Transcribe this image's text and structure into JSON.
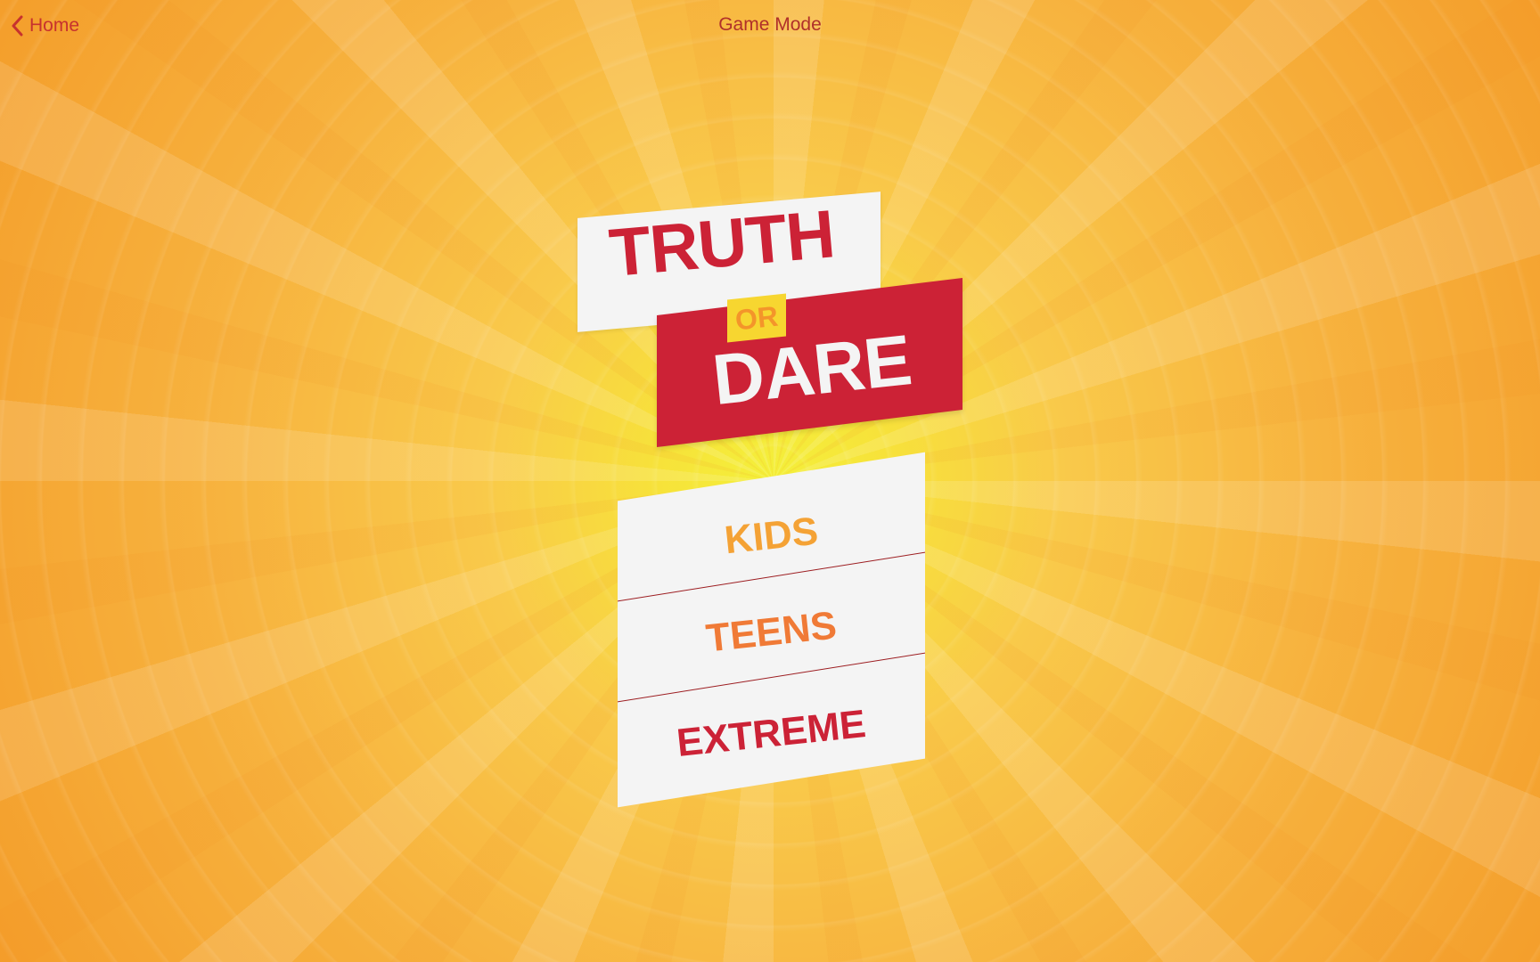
{
  "nav": {
    "back_label": "Home",
    "back_icon": "chevron-left-icon",
    "title": "Game Mode"
  },
  "logo": {
    "truth": "TRUTH",
    "or": "OR",
    "dare": "DARE"
  },
  "modes": [
    {
      "label": "KIDS",
      "color": "#f4a235"
    },
    {
      "label": "TEENS",
      "color": "#f07a36"
    },
    {
      "label": "EXTREME",
      "color": "#cc2236"
    }
  ],
  "colors": {
    "accent_red": "#cc2236",
    "fold_dark_red": "#9c1c20",
    "or_yellow": "#f7d630",
    "card_white": "#f4f4f4",
    "background_orange": "#f49f2c",
    "background_yellow": "#f4f03a"
  }
}
